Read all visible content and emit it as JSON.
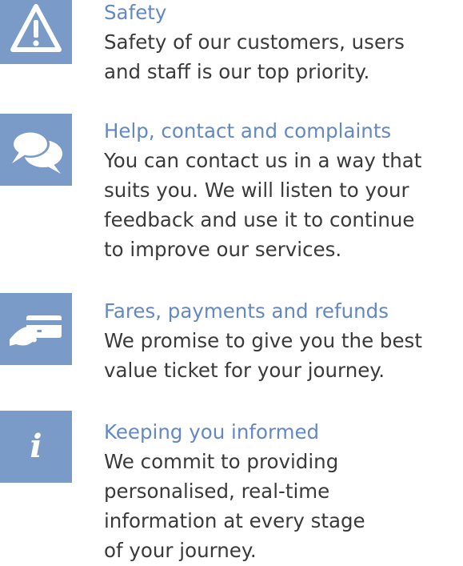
{
  "accent_color": "#6488c2",
  "icon_bg_color": "#7a9ac7",
  "text_color": "#3a3a3a",
  "items": [
    {
      "icon": "warning-triangle-icon",
      "title": "Safety",
      "lines": [
        "Safety of our customers, users",
        "and staff is our top priority."
      ]
    },
    {
      "icon": "speech-bubbles-icon",
      "title": "Help, contact and complaints",
      "lines": [
        "You can contact us in a way that",
        "suits you. We will listen to your",
        "feedback and use it to continue",
        "to improve our services."
      ]
    },
    {
      "icon": "card-payment-icon",
      "title": "Fares, payments and refunds",
      "lines": [
        "We promise to give you the best",
        "value ticket for your journey."
      ]
    },
    {
      "icon": "info-icon",
      "title": "Keeping you informed",
      "lines": [
        "We commit to providing",
        "personalised, real-time",
        "information at every stage",
        "of your journey."
      ]
    }
  ]
}
